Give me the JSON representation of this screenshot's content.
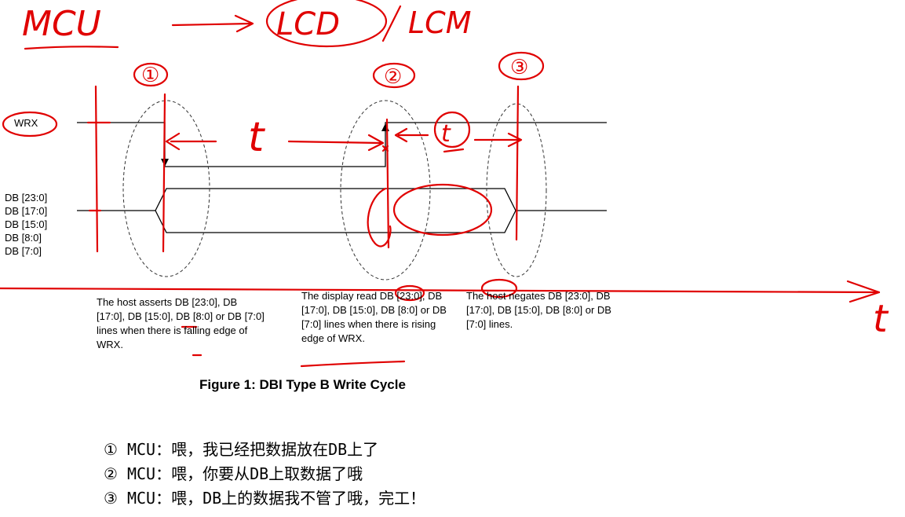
{
  "annotations": {
    "header_left": "MCU",
    "header_mid": "LCD",
    "header_right": "LCM",
    "marker_1": "①",
    "marker_2": "②",
    "marker_3": "③",
    "time_t": "t",
    "time_t_prime": "t",
    "time_axis": "t"
  },
  "signals": {
    "wrx": "WRX",
    "db_23": "DB [23:0]",
    "db_17": "DB [17:0]",
    "db_15": "DB [15:0]",
    "db_8": "DB [8:0]",
    "db_7": "DB [7:0]"
  },
  "captions": {
    "c1": "The host asserts DB [23:0], DB [17:0], DB [15:0], DB [8:0] or DB [7:0] lines when there is falling edge of WRX.",
    "c2": "The display read DB [23:0], DB [17:0], DB [15:0], DB [8:0] or DB [7:0] lines when there is rising edge of WRX.",
    "c3": "The host negates DB [23:0], DB [17:0], DB [15:0], DB [8:0] or DB [7:0] lines."
  },
  "figure_title": "Figure 1: DBI Type B Write Cycle",
  "notes": [
    "① MCU：喂，我已经把数据放在DB上了",
    "② MCU：喂，你要从DB上取数据了哦",
    "③ MCU：喂，DB上的数据我不管了哦，完工！"
  ],
  "colors": {
    "ink_red": "#e00000",
    "line_black": "#000000",
    "dashed_gray": "#333333"
  }
}
